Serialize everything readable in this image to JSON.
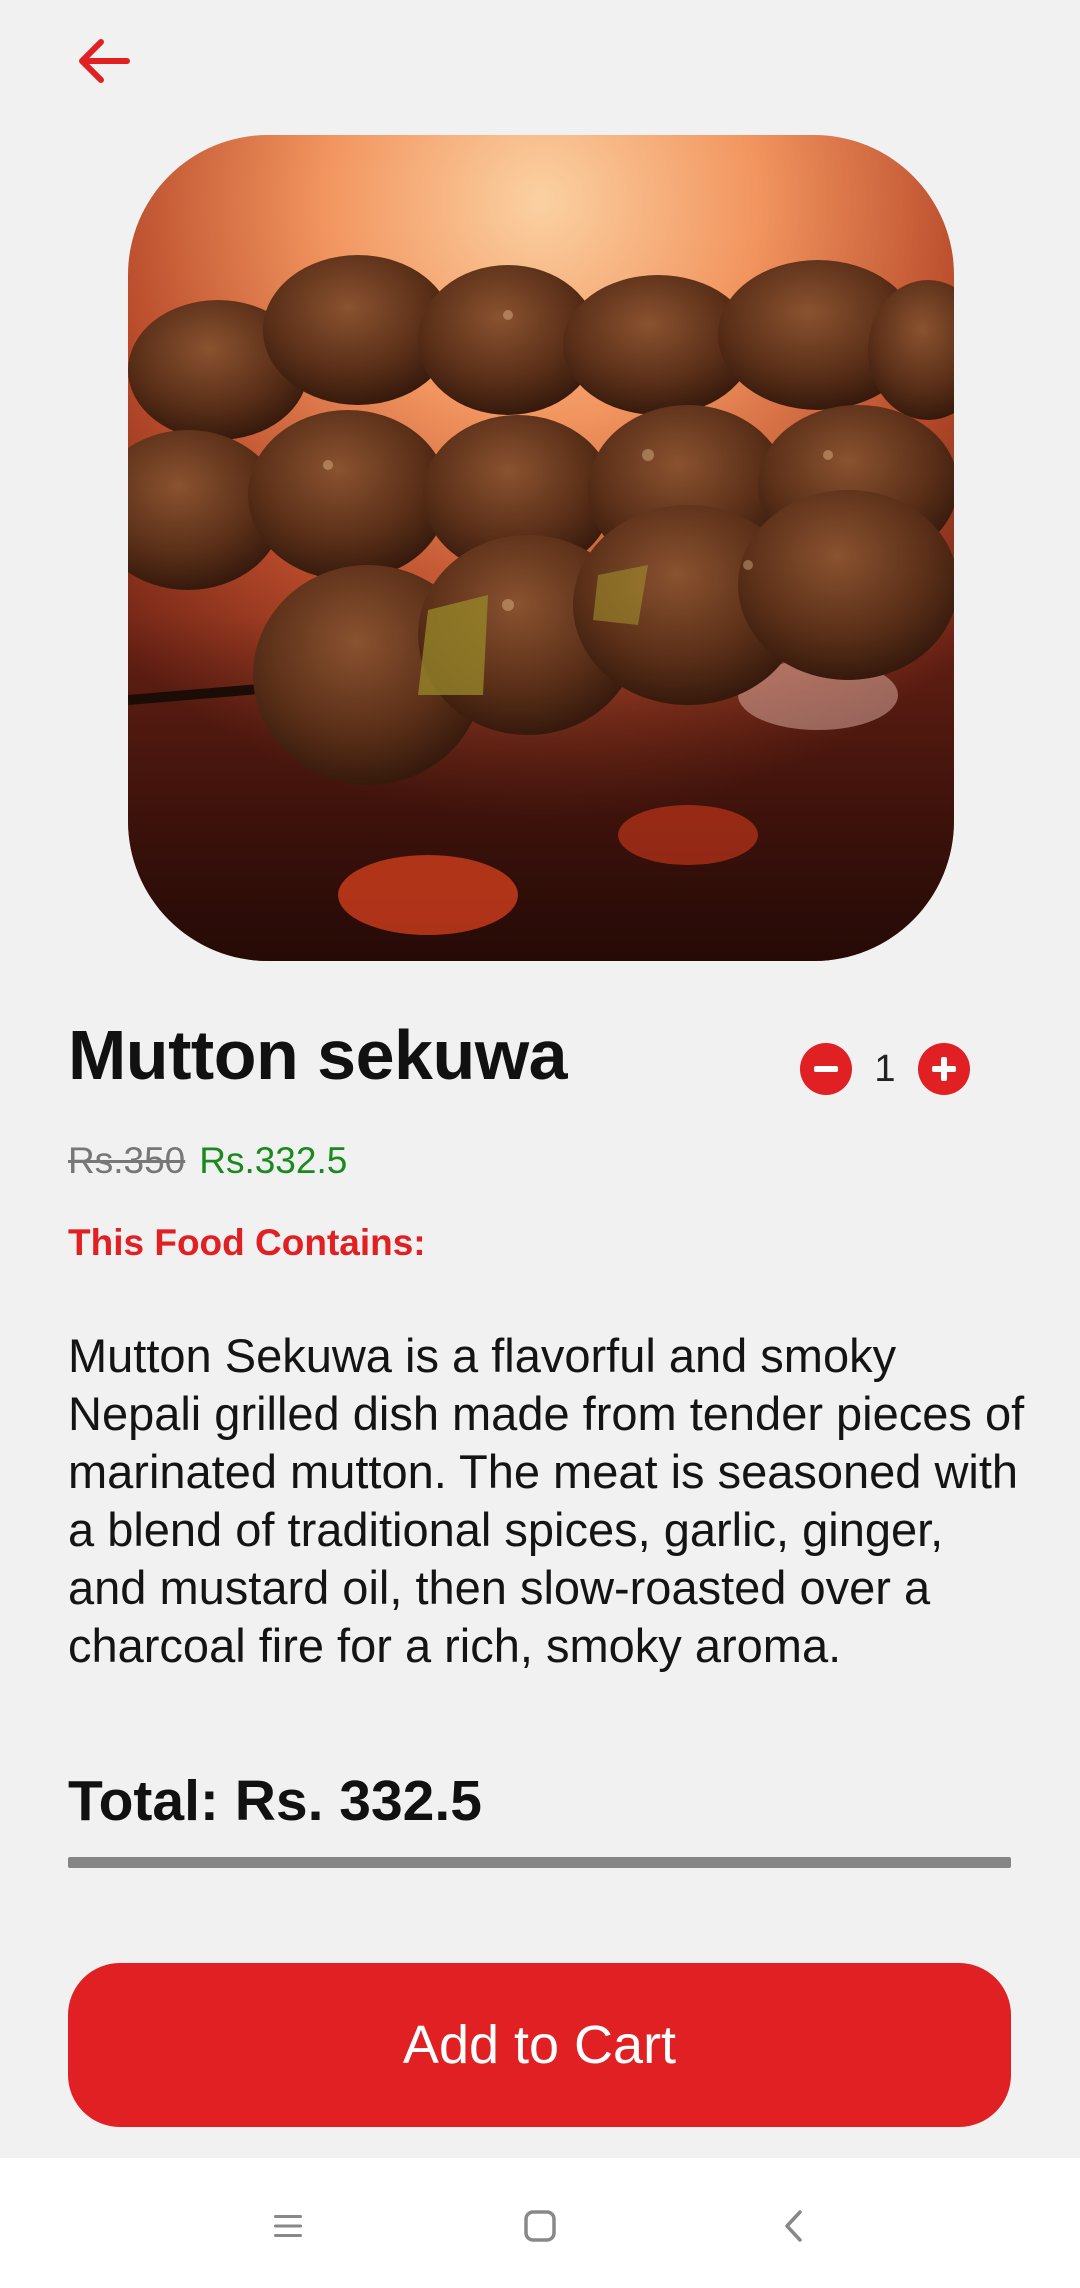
{
  "header": {
    "back_icon": "arrow-left-icon"
  },
  "product": {
    "image_alt": "Mutton sekuwa skewers over charcoal fire",
    "name": "Mutton sekuwa",
    "quantity": "1",
    "old_price": "Rs.350",
    "new_price": "Rs.332.5",
    "contains_label": "This Food Contains:",
    "description": "Mutton Sekuwa is a flavorful and smoky Nepali grilled dish made from tender pieces of marinated mutton. The meat is seasoned with a blend of traditional spices, garlic, ginger, and mustard oil, then slow-roasted over a charcoal fire for a rich, smoky aroma.",
    "total": "Total: Rs. 332.5"
  },
  "actions": {
    "add_to_cart_label": "Add to Cart"
  },
  "system_nav": {
    "items": [
      "menu-icon",
      "home-icon",
      "back-icon"
    ]
  },
  "colors": {
    "accent": "#e02023",
    "discount_price": "#1a8a1f",
    "background": "#f1f1f1"
  }
}
